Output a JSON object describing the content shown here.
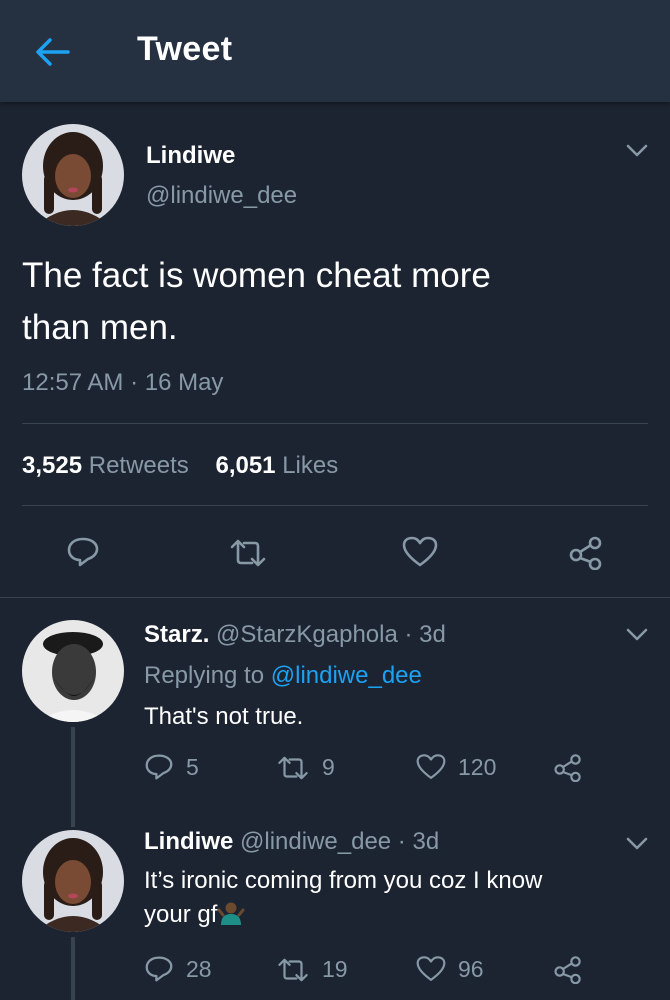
{
  "header": {
    "title": "Tweet"
  },
  "tweet": {
    "name": "Lindiwe",
    "handle": "@lindiwe_dee",
    "text_line1": "The fact is women cheat more",
    "text_line2": "than men.",
    "timestamp": "12:57 AM · 16 May",
    "retweets_count": "3,525",
    "retweets_label": "Retweets",
    "likes_count": "6,051",
    "likes_label": "Likes"
  },
  "replies": [
    {
      "name": "Starz.",
      "handle_time": "@StarzKgaphola · 3d",
      "replying_prefix": "Replying to ",
      "replying_to": "@lindiwe_dee",
      "text_line1": "That's not true.",
      "replies": "5",
      "retweets": "9",
      "likes": "120"
    },
    {
      "name": "Lindiwe",
      "handle_time": "@lindiwe_dee · 3d",
      "text_line1": "It’s ironic coming from you coz I know",
      "text_line2": "your gf",
      "replies": "28",
      "retweets": "19",
      "likes": "96"
    }
  ],
  "colors": {
    "background": "#1c2431",
    "header": "#253041",
    "accent_blue": "#1da1f2",
    "secondary_text": "#8899a6",
    "divider": "#38444d"
  },
  "icons": [
    "back-arrow-icon",
    "chevron-down-icon",
    "reply-icon",
    "retweet-icon",
    "like-heart-icon",
    "share-icon",
    "shrug-emoji-icon"
  ]
}
